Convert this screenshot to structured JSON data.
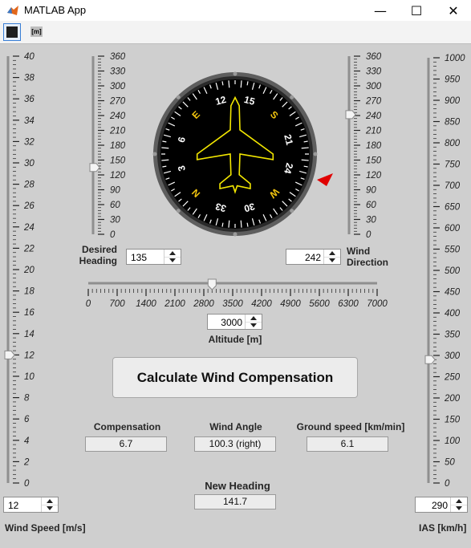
{
  "window": {
    "title": "MATLAB App",
    "minimize": "—",
    "maximize": "☐",
    "close": "✕"
  },
  "toolbar": {
    "btn2_label": "[m]"
  },
  "wind_speed": {
    "ticks": [
      "40",
      "38",
      "36",
      "34",
      "32",
      "30",
      "28",
      "26",
      "24",
      "22",
      "20",
      "18",
      "16",
      "14",
      "12",
      "10",
      "8",
      "6",
      "4",
      "2",
      "0"
    ],
    "value": "12",
    "label": "Wind Speed [m/s]",
    "slider_fraction": 0.3
  },
  "heading": {
    "ticks": [
      "360",
      "330",
      "300",
      "270",
      "240",
      "210",
      "180",
      "150",
      "120",
      "90",
      "60",
      "30",
      "0"
    ],
    "value": "135",
    "label_line1": "Desired",
    "label_line2": "Heading",
    "slider_fraction": 0.375
  },
  "wind_direction": {
    "ticks": [
      "360",
      "330",
      "300",
      "270",
      "240",
      "210",
      "180",
      "150",
      "120",
      "90",
      "60",
      "30",
      "0"
    ],
    "value": "242",
    "label_line1": "Wind",
    "label_line2": "Direction",
    "slider_fraction": 0.672
  },
  "ias": {
    "ticks": [
      "1000",
      "950",
      "900",
      "850",
      "800",
      "750",
      "700",
      "650",
      "600",
      "550",
      "500",
      "450",
      "400",
      "350",
      "300",
      "250",
      "200",
      "150",
      "100",
      "50",
      "0"
    ],
    "value": "290",
    "label": "IAS [km/h]",
    "slider_fraction": 0.29
  },
  "altitude": {
    "ticks": [
      "0",
      "700",
      "1400",
      "2100",
      "2800",
      "3500",
      "4200",
      "4900",
      "5600",
      "6300",
      "7000"
    ],
    "value": "3000",
    "label": "Altitude [m]",
    "slider_fraction": 0.4286
  },
  "compass": {
    "labels": [
      "E",
      "12",
      "15",
      "S",
      "21",
      "24",
      "W",
      "30",
      "33",
      "N",
      "3",
      "6"
    ],
    "label_colors": [
      "#f1c40f",
      "#ffffff",
      "#ffffff",
      "#f1c40f",
      "#ffffff",
      "#ffffff",
      "#f1c40f",
      "#ffffff",
      "#ffffff",
      "#f1c40f",
      "#ffffff",
      "#ffffff"
    ],
    "heading_deg": 135,
    "pointer_color": "#e00000",
    "plane_color": "#f2e600"
  },
  "calculate_button": "Calculate Wind Compensation",
  "outputs": {
    "compensation_label": "Compensation",
    "compensation": "6.7",
    "wind_angle_label": "Wind Angle",
    "wind_angle": "100.3 (right)",
    "ground_speed_label": "Ground speed [km/min]",
    "ground_speed": "6.1",
    "new_heading_label": "New Heading",
    "new_heading": "141.7"
  }
}
